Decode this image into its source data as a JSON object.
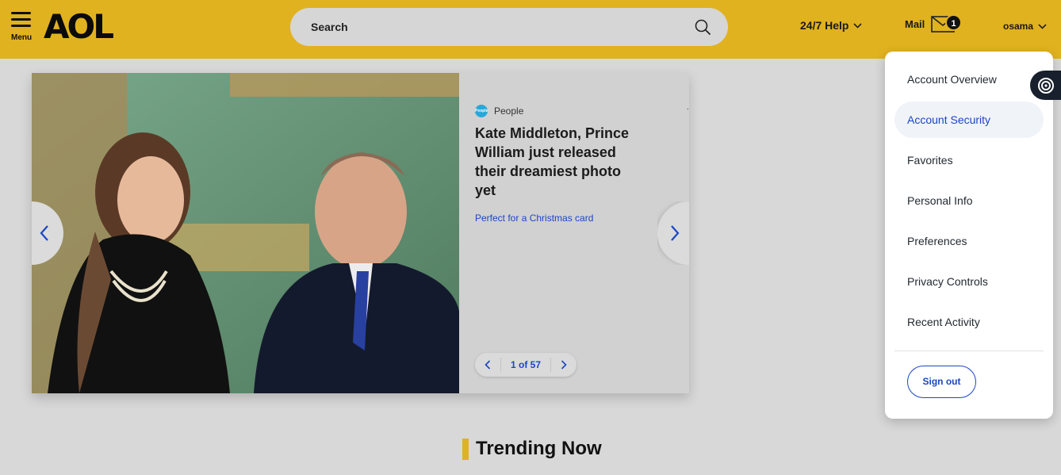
{
  "header": {
    "menu_label": "Menu",
    "logo_text": "AOL",
    "search_placeholder": "Search",
    "help_label": "24/7 Help",
    "mail_label": "Mail",
    "mail_count": "1",
    "username": "osama",
    "brand_color": "#e1b21f"
  },
  "carousel": {
    "source_icon_text": "People",
    "source": "People",
    "headline": "Kate Middleton, Prince William just released their dreamiest photo yet",
    "subhead": "Perfect for a Christmas card",
    "pager": "1 of 57",
    "partial_text": "."
  },
  "trending": {
    "title": "Trending Now"
  },
  "account_menu": {
    "items": [
      {
        "label": "Account Overview"
      },
      {
        "label": "Account Security"
      },
      {
        "label": "Favorites"
      },
      {
        "label": "Personal Info"
      },
      {
        "label": "Preferences"
      },
      {
        "label": "Privacy Controls"
      },
      {
        "label": "Recent Activity"
      }
    ],
    "active_item": "Account Security",
    "signout_label": "Sign out"
  }
}
